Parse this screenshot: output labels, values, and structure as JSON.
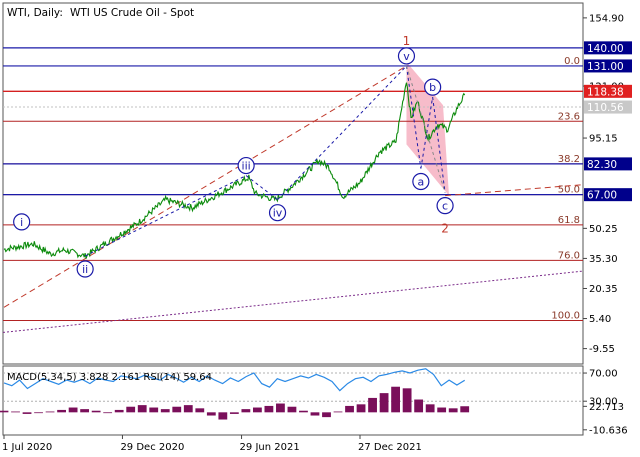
{
  "header": {
    "symbol": "WTI, Daily:",
    "title": "WTI US Crude Oil - Spot"
  },
  "colors": {
    "price": "#0b8a0b",
    "fib": "#b22222",
    "wave_blue": "#1a1aa8",
    "wave_red": "#c0392b",
    "channel": "#7b2c8a",
    "zone": "#f4a6b8",
    "macd_hist": "#7a0f5a",
    "rsi": "#2b8ae6"
  },
  "chart_data": [
    {
      "type": "line",
      "title": "WTI US Crude Oil - Spot",
      "timeframe": "Daily",
      "ylim": [
        -17.2,
        162.3
      ],
      "price_ticks": [
        "154.90",
        "121.00",
        "95.15",
        "50.25",
        "35.30",
        "20.35",
        "5.40",
        "-9.55"
      ],
      "x_ticks": [
        "1 Jul 2020",
        "29 Dec 2020",
        "29 Jun 2021",
        "27 Dec 2021"
      ],
      "price_series": {
        "name": "WTI",
        "x": [
          "2020-07-01",
          "2020-08-15",
          "2020-09-10",
          "2020-10-01",
          "2020-11-02",
          "2020-12-29",
          "2021-01-20",
          "2021-03-05",
          "2021-04-15",
          "2021-05-20",
          "2021-06-29",
          "2021-07-10",
          "2021-07-20",
          "2021-08-20",
          "2021-09-15",
          "2021-10-25",
          "2021-11-10",
          "2021-12-01",
          "2021-12-27",
          "2022-01-25",
          "2022-02-20",
          "2022-03-08",
          "2022-03-15",
          "2022-03-25",
          "2022-04-10",
          "2022-04-25",
          "2022-05-10",
          "2022-05-25",
          "2022-06-05"
        ],
        "values": [
          39.8,
          42.5,
          37.5,
          39.5,
          36.5,
          48.0,
          52.5,
          64.5,
          60.5,
          66.5,
          73.5,
          75.5,
          67.5,
          64.5,
          71.5,
          84.0,
          80.5,
          66.0,
          73.0,
          88.0,
          93.5,
          124.0,
          105.0,
          113.5,
          95.0,
          102.0,
          99.5,
          110.5,
          116.5
        ]
      },
      "horizontal_levels": [
        {
          "label": "140.00",
          "value": 140.0,
          "kind": "blue"
        },
        {
          "label": "131.00",
          "value": 131.0,
          "kind": "blue"
        },
        {
          "label": "118.38",
          "value": 118.38,
          "kind": "red"
        },
        {
          "label": "110.56",
          "value": 110.56,
          "kind": "current"
        },
        {
          "label": "82.30",
          "value": 82.3,
          "kind": "blue"
        },
        {
          "label": "67.00",
          "value": 67.0,
          "kind": "blue"
        }
      ],
      "fibonacci_levels": [
        {
          "label": "0.0",
          "value": 131.0
        },
        {
          "label": "23.6",
          "value": 103.5
        },
        {
          "label": "38.2",
          "value": 82.3
        },
        {
          "label": "50.0",
          "value": 67.0
        },
        {
          "label": "61.8",
          "value": 52.0
        },
        {
          "label": "76.0",
          "value": 34.3
        },
        {
          "label": "100.0",
          "value": 4.4
        }
      ],
      "wave_labels": [
        {
          "label": "i",
          "x": "2020-07-28",
          "value": 48.5,
          "style": "circle"
        },
        {
          "label": "ii",
          "x": "2020-11-02",
          "value": 36.5,
          "style": "circle"
        },
        {
          "label": "iii",
          "x": "2021-07-06",
          "value": 76.5,
          "style": "circle"
        },
        {
          "label": "iv",
          "x": "2021-08-23",
          "value": 64.5,
          "style": "circle"
        },
        {
          "label": "v",
          "x": "2022-03-08",
          "value": 131.0,
          "style": "circle"
        },
        {
          "label": "a",
          "x": "2022-03-30",
          "value": 80.0,
          "style": "circle"
        },
        {
          "label": "b",
          "x": "2022-04-17",
          "value": 115.5,
          "style": "circle"
        },
        {
          "label": "c",
          "x": "2022-05-06",
          "value": 68.0,
          "style": "circle"
        },
        {
          "label": "1",
          "x": "2022-03-08",
          "value": 131.0,
          "style": "red"
        },
        {
          "label": "2",
          "x": "2022-05-06",
          "value": 68.0,
          "style": "red"
        }
      ]
    },
    {
      "type": "line",
      "title": "MACD(5,34,5) 3.828 2.161 RSI(14) 59.64",
      "indicator_label": "MACD(5,34,5) 3.828 2.161 RSI(14) 59.64",
      "ylim": [
        -18.0,
        80.0
      ],
      "ticks": [
        "22.713",
        "70.00",
        "30.00",
        "-10.636"
      ],
      "series": [
        {
          "name": "MACD",
          "type": "bar",
          "values": [
            1.0,
            0.5,
            -1.0,
            -0.5,
            0.5,
            1.5,
            3.0,
            2.0,
            1.0,
            -0.5,
            1.5,
            3.5,
            4.5,
            3.0,
            2.0,
            3.5,
            4.5,
            2.5,
            -2.0,
            -4.5,
            -1.0,
            2.0,
            3.0,
            4.0,
            5.5,
            3.5,
            1.0,
            -2.0,
            -3.0,
            0.5,
            4.0,
            5.0,
            9.0,
            12.0,
            16.0,
            15.0,
            8.0,
            5.0,
            3.0,
            2.5,
            3.8
          ]
        },
        {
          "name": "RSI",
          "type": "line",
          "values": [
            56,
            52,
            60,
            48,
            55,
            62,
            58,
            54,
            60,
            57,
            61,
            55,
            63,
            60,
            58,
            66,
            64,
            62,
            67,
            63,
            60,
            68,
            63,
            57,
            64,
            58,
            66,
            60,
            55,
            63,
            58,
            65,
            70,
            55,
            50,
            62,
            58,
            62,
            66,
            63,
            68,
            64,
            58,
            45,
            55,
            62,
            64,
            58,
            66,
            68,
            71,
            73,
            70,
            74,
            76,
            68,
            52,
            60,
            53,
            59.64
          ]
        }
      ]
    }
  ]
}
